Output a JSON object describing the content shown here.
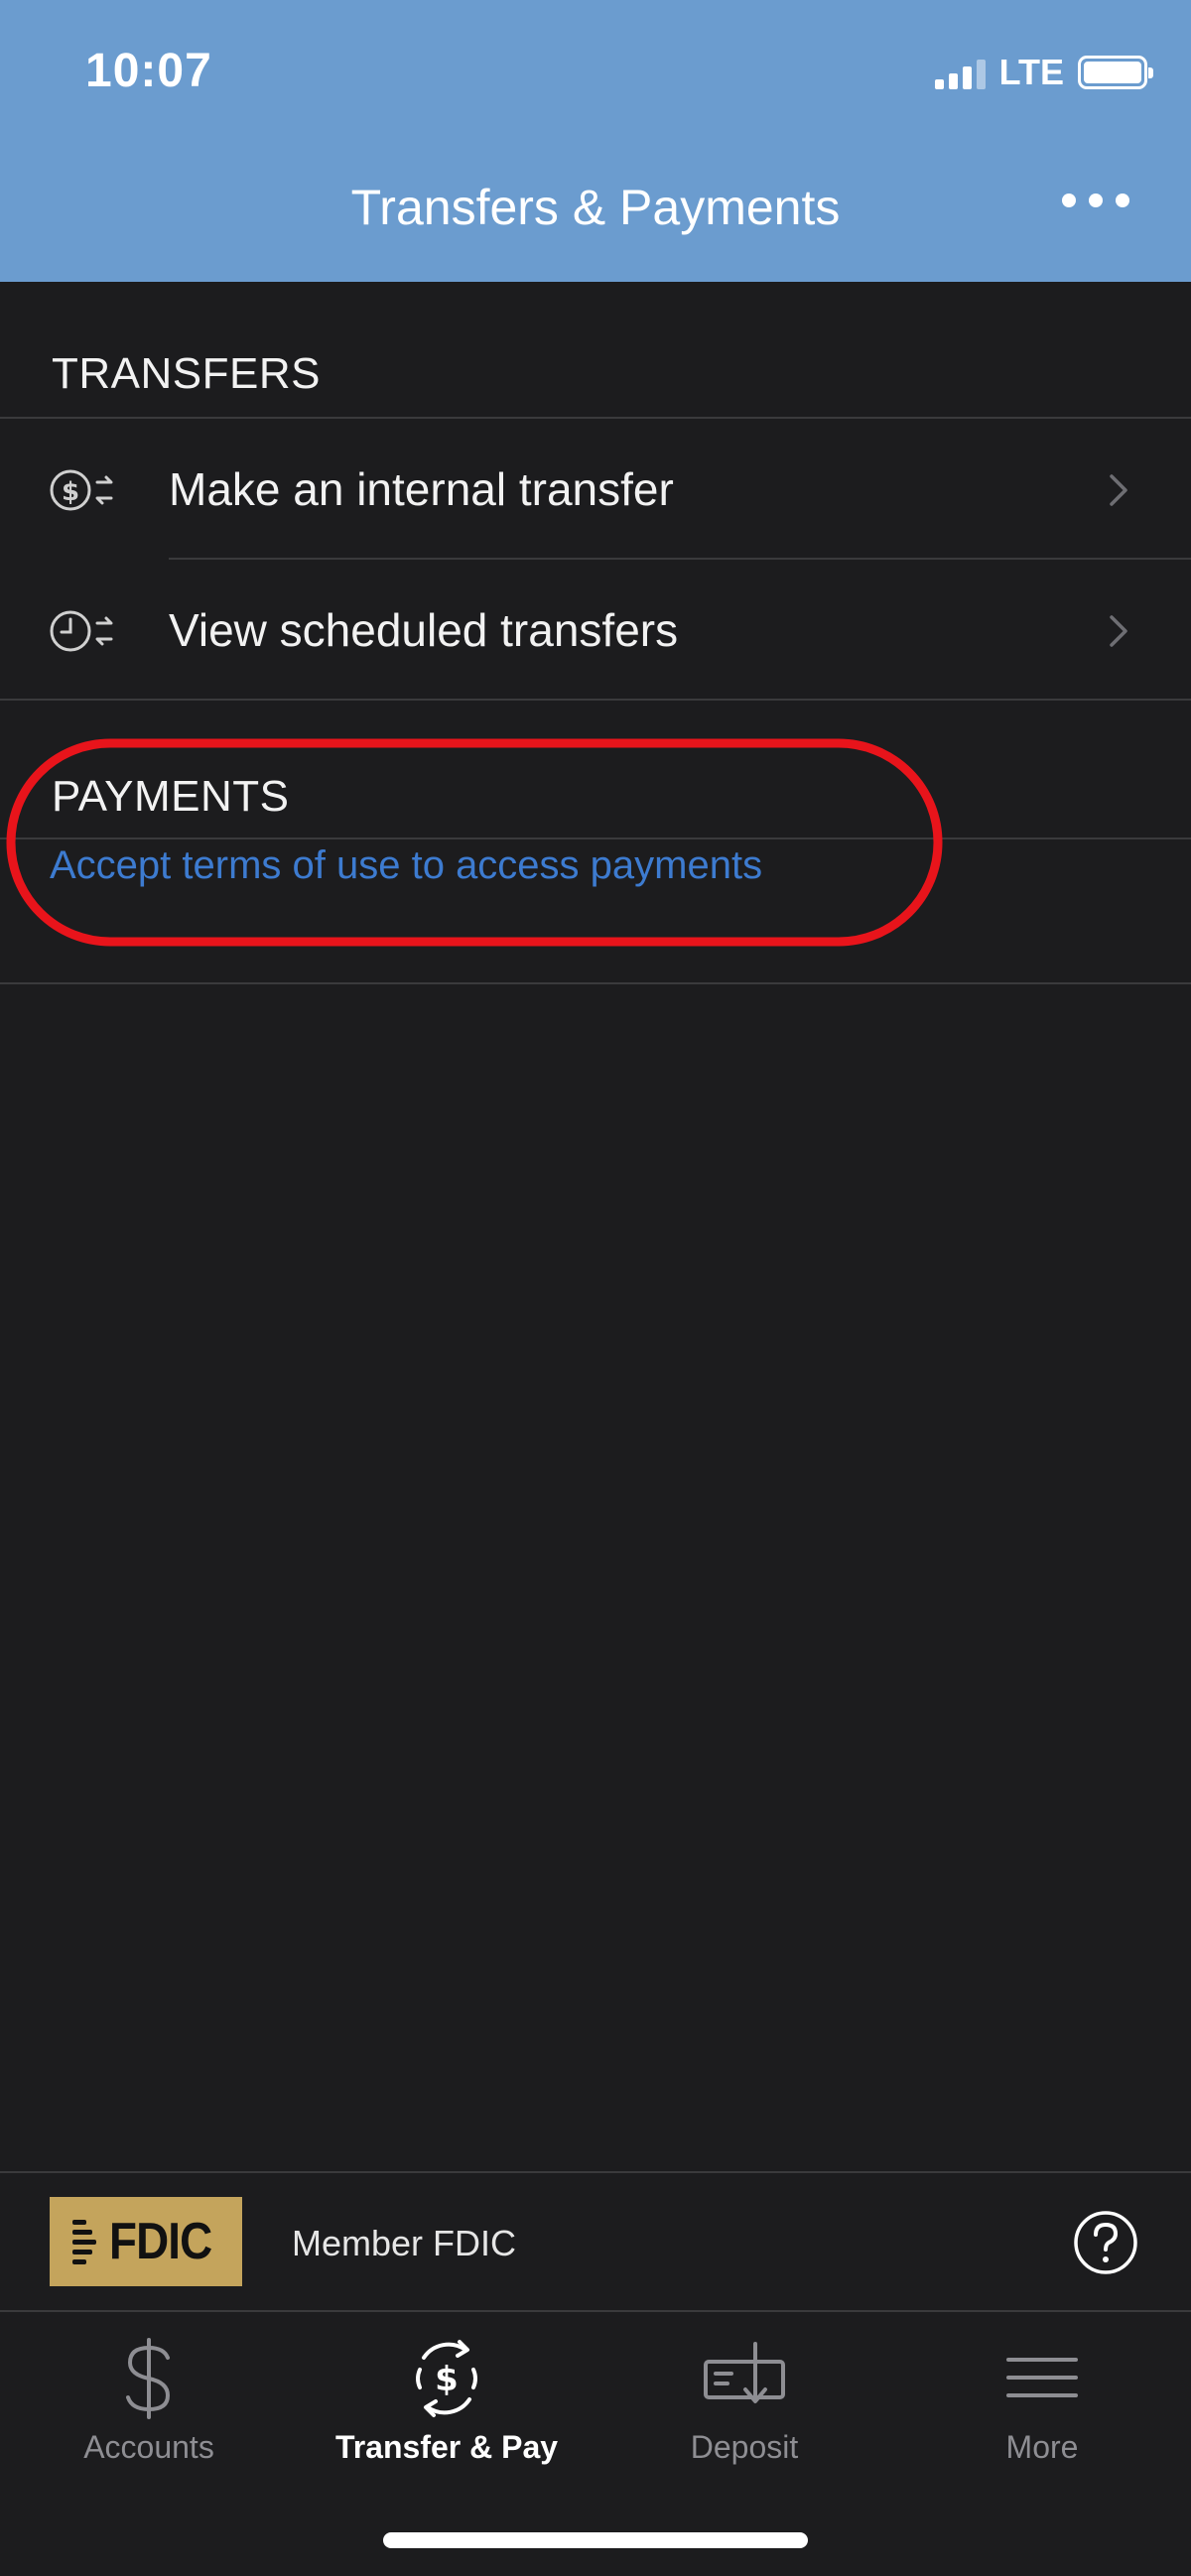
{
  "status_bar": {
    "time": "10:07",
    "network": "LTE"
  },
  "header": {
    "title": "Transfers & Payments",
    "more_icon": "ellipsis-icon",
    "background_color": "#6b9ccf"
  },
  "transfers": {
    "section_title": "TRANSFERS",
    "items": [
      {
        "label": "Make an internal transfer",
        "icon": "dollar-transfer-icon"
      },
      {
        "label": "View scheduled transfers",
        "icon": "clock-transfer-icon"
      }
    ]
  },
  "payments": {
    "section_title": "PAYMENTS",
    "link": "Accept terms of use to access payments",
    "link_color": "#3d7bd0"
  },
  "footer": {
    "fdic_logo_text": "FDIC",
    "member_text": "Member FDIC",
    "help_icon": "question-circle-icon"
  },
  "tab_bar": {
    "tabs": [
      {
        "label": "Accounts",
        "icon": "dollar-sign-icon",
        "active": false
      },
      {
        "label": "Transfer & Pay",
        "icon": "transfer-pay-icon",
        "active": true
      },
      {
        "label": "Deposit",
        "icon": "check-deposit-icon",
        "active": false
      },
      {
        "label": "More",
        "icon": "hamburger-menu-icon",
        "active": false
      }
    ]
  },
  "colors": {
    "background": "#1c1c1e",
    "annotation": "#e8141b"
  }
}
